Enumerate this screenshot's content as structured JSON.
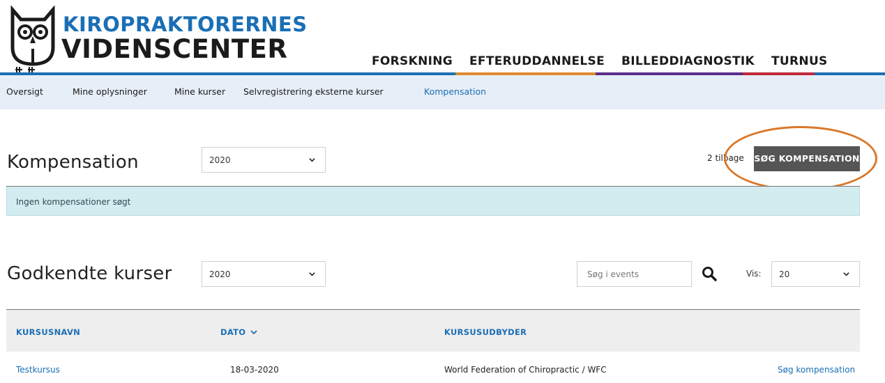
{
  "header": {
    "logo_line1": "KIROPRAKTORERNES",
    "logo_line2": "VIDENSCENTER",
    "main_nav": [
      {
        "label": "FORSKNING",
        "color": "#1a6fb5"
      },
      {
        "label": "EFTERUDDANNELSE",
        "color": "#e08a2e"
      },
      {
        "label": "BILLEDDIAGNOSTIK",
        "color": "#5a2e8c"
      },
      {
        "label": "TURNUS",
        "color": "#c0283a"
      }
    ],
    "accent_green": "#3b9b4b"
  },
  "subnav": {
    "items": [
      {
        "label": "Oversigt"
      },
      {
        "label": "Mine oplysninger"
      },
      {
        "label": "Mine kurser"
      },
      {
        "label": "Selvregistrering eksterne kurser"
      },
      {
        "label": "Kompensation"
      }
    ],
    "active": "Kompensation"
  },
  "kompensation": {
    "title": "Kompensation",
    "year_select": "2020",
    "remaining_text": "2 tilbage",
    "button_label": "SØG KOMPENSATION",
    "alert_text": "Ingen kompensationer søgt"
  },
  "godkendte": {
    "title": "Godkendte kurser",
    "year_select": "2020",
    "search_placeholder": "Søg i events",
    "vis_label": "Vis:",
    "vis_select": "20",
    "columns": [
      "KURSUSNAVN",
      "DATO",
      "KURSUSUDBYDER"
    ],
    "rows": [
      {
        "name": "Testkursus",
        "date": "18-03-2020",
        "provider": "World Federation of Chiropractic / WFC",
        "action": "Søg kompensation"
      }
    ]
  },
  "colors": {
    "brand_blue": "#1a6fb5",
    "button_dark": "#555555",
    "highlight_orange": "#d9782a",
    "alert_bg": "#d3ecef",
    "subnav_bg": "#e6eef7"
  }
}
